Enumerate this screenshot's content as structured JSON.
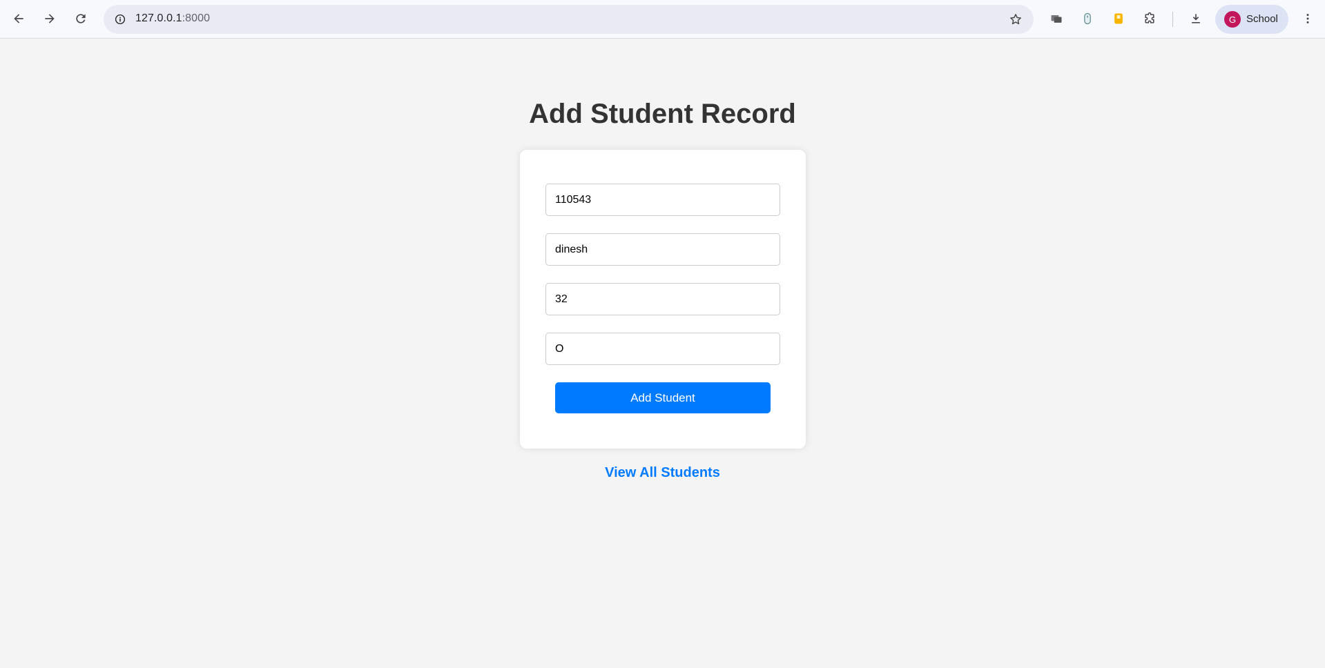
{
  "browser": {
    "url_host": "127.0.0.1",
    "url_port": ":8000",
    "profile_initial": "G",
    "profile_name": "School",
    "icons": [
      "back-icon",
      "forward-icon",
      "reload-icon",
      "site-info-icon",
      "bookmark-star-icon",
      "extension-icon",
      "extensions-puzzle-icon",
      "download-icon",
      "more-menu-icon"
    ]
  },
  "page": {
    "title": "Add Student Record",
    "form": {
      "fields": [
        {
          "value": "110543"
        },
        {
          "value": "dinesh"
        },
        {
          "value": "32"
        },
        {
          "value": "O"
        }
      ],
      "submit_label": "Add Student"
    },
    "view_all_label": "View All Students"
  },
  "colors": {
    "accent": "#007bff",
    "page_bg": "#f4f4f4",
    "title": "#333333"
  }
}
